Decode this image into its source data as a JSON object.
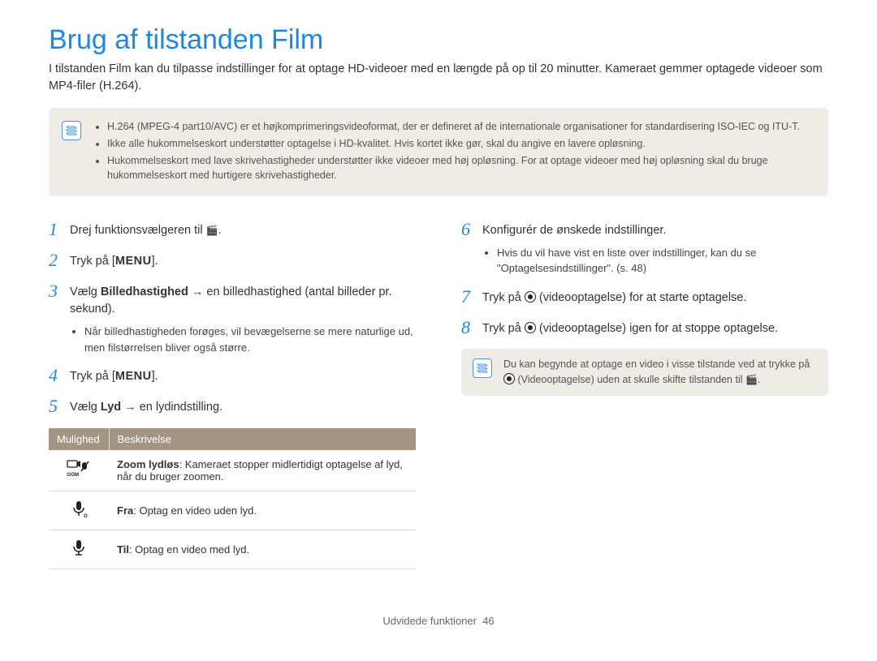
{
  "title": "Brug af tilstanden Film",
  "intro": "I tilstanden Film kan du tilpasse indstillinger for at optage HD-videoer med en længde på op til 20 minutter. Kameraet gemmer optagede videoer som MP4-filer (H.264).",
  "top_note_items": [
    "H.264 (MPEG-4 part10/AVC) er et højkomprimeringsvideoformat, der er defineret af de internationale organisationer for standardisering ISO-IEC og ITU-T.",
    "Ikke alle hukommelseskort understøtter optagelse i HD-kvalitet. Hvis kortet ikke gør, skal du angive en lavere opløsning.",
    "Hukommelseskort med lave skrivehastigheder understøtter ikke videoer med høj opløsning. For at optage videoer med høj opløsning skal du bruge hukommelseskort med hurtigere skrivehastigheder."
  ],
  "steps_left": {
    "s1": {
      "num": "1",
      "pre": "Drej funktionsvælgeren til ",
      "post": "."
    },
    "s2": {
      "num": "2",
      "pre": "Tryk på [",
      "menu": "MENU",
      "post": "]."
    },
    "s3": {
      "num": "3",
      "pre": "Vælg ",
      "bold": "Billedhastighed",
      "mid": " → en billedhastighed (antal billeder pr. sekund).",
      "bullet": "Når billedhastigheden forøges, vil bevægelserne se mere naturlige ud, men filstørrelsen bliver også større."
    },
    "s4": {
      "num": "4",
      "pre": "Tryk på [",
      "menu": "MENU",
      "post": "]."
    },
    "s5": {
      "num": "5",
      "pre": "Vælg ",
      "bold": "Lyd",
      "post": " → en lydindstilling."
    }
  },
  "table": {
    "h1": "Mulighed",
    "h2": "Beskrivelse",
    "rows": [
      {
        "icon": "zoom",
        "label": "Zoom lydløs",
        "desc": ": Kameraet stopper midlertidigt optagelse af lyd, når du bruger zoomen."
      },
      {
        "icon": "mic-off",
        "label": "Fra",
        "desc": ": Optag en video uden lyd."
      },
      {
        "icon": "mic-on",
        "label": "Til",
        "desc": ": Optag en video med lyd."
      }
    ]
  },
  "steps_right": {
    "s6": {
      "num": "6",
      "text": "Konfigurér de ønskede indstillinger.",
      "bullet": "Hvis du vil have vist en liste over indstillinger, kan du se \"Optagelsesindstillinger\". (s. 48)"
    },
    "s7": {
      "num": "7",
      "pre": "Tryk på ",
      "post": " (videooptagelse) for at starte optagelse."
    },
    "s8": {
      "num": "8",
      "pre": "Tryk på ",
      "post": " (videooptagelse) igen for at stoppe optagelse."
    }
  },
  "bottom_note": {
    "pre": "Du kan begynde at optage en video i visse tilstande ved at trykke på ",
    "post": " (Videooptagelse) uden at skulle skifte tilstanden til "
  },
  "footer": {
    "section": "Udvidede funktioner",
    "page": "46"
  }
}
